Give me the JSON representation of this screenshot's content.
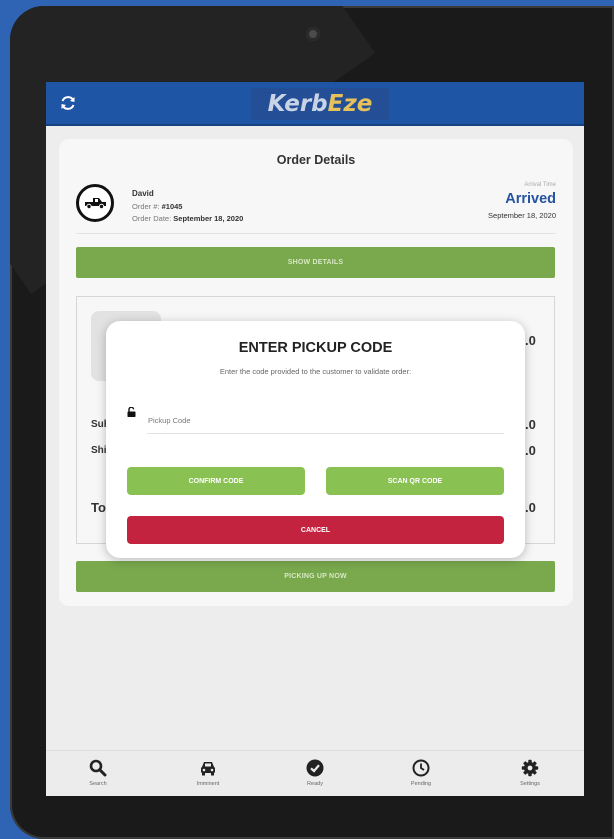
{
  "app": {
    "logo_part1": "Kerb",
    "logo_part2": "Eze"
  },
  "order": {
    "title": "Order Details",
    "customer_name": "David",
    "order_number_label": "Order #:",
    "order_number": "#1045",
    "order_date_label": "Order Date:",
    "order_date": "September 18, 2020",
    "arrival_label": "Arrival Time",
    "arrival_status": "Arrived",
    "arrival_date": "September 18, 2020",
    "show_details_label": "SHOW DETAILS",
    "picking_up_label": "PICKING UP NOW"
  },
  "peeks": {
    "subtotal": "Sub",
    "shipping": "Shi",
    "total": "To",
    "value1": ".0",
    "value2": ".0",
    "value3": ".0",
    "value4": ".0"
  },
  "modal": {
    "title": "ENTER PICKUP CODE",
    "subtitle": "Enter the code provided to the customer to validate order:",
    "input_placeholder": "Pickup Code",
    "input_value": "",
    "confirm_label": "CONFIRM CODE",
    "scan_label": "SCAN QR CODE",
    "cancel_label": "CANCEL"
  },
  "nav": [
    {
      "label": "Search",
      "icon": "search-icon"
    },
    {
      "label": "Imminent",
      "icon": "car-icon"
    },
    {
      "label": "Ready",
      "icon": "check-circle-icon"
    },
    {
      "label": "Pending",
      "icon": "clock-icon"
    },
    {
      "label": "Settings",
      "icon": "gear-icon"
    }
  ],
  "colors": {
    "background": "#2f63b3",
    "appbar": "#1f55a5",
    "primary_green": "#79a84d",
    "modal_green": "#8ac153",
    "cancel_red": "#c4233f",
    "arrived_blue": "#2453a0"
  }
}
